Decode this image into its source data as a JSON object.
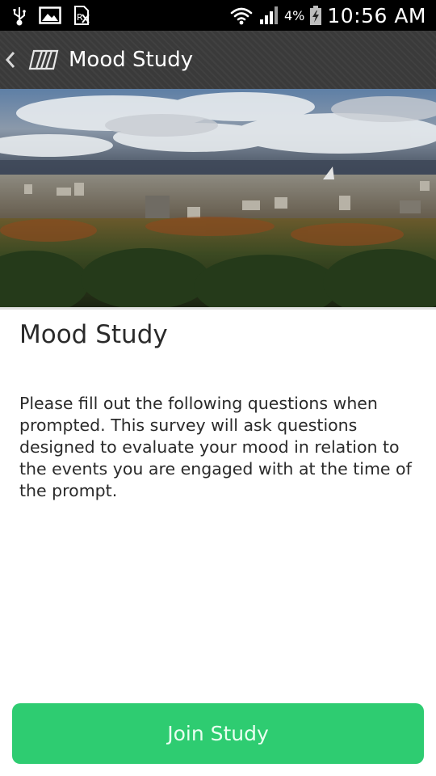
{
  "status_bar": {
    "left_icons": [
      "usb-icon",
      "image-icon",
      "sim-card-icon"
    ],
    "right_icons": [
      "wifi-icon",
      "signal-icon",
      "battery-icon"
    ],
    "battery_percent": "4%",
    "time": "10:56 AM"
  },
  "action_bar": {
    "up_icon": "chevron-left-icon",
    "logo_icon": "striped-logo-icon",
    "title": "Mood Study"
  },
  "hero": {
    "image": "city-landscape-photo"
  },
  "study": {
    "title": "Mood Study",
    "description": "Please fill out the following questions when prompted. This survey will ask questions designed to evaluate your mood in relation to the events you are engaged with at the time of the prompt."
  },
  "join_button": {
    "label": "Join Study",
    "color": "#2ecc71"
  }
}
